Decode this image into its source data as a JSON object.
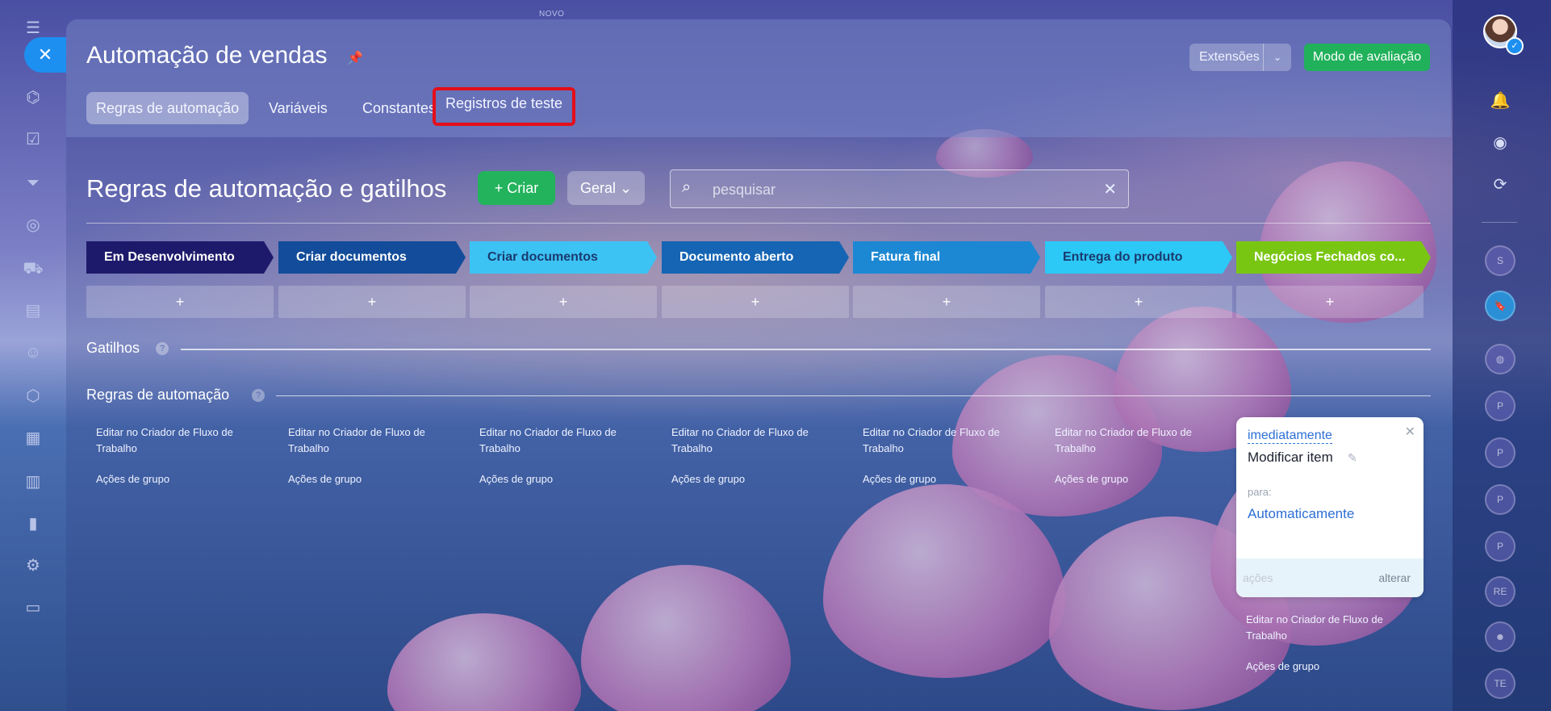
{
  "topbar": {
    "novo_label": "NOVO"
  },
  "header": {
    "title": "Automação de vendas",
    "extensions_label": "Extensões",
    "demo_mode_label": "Modo de avaliação"
  },
  "tabs": [
    {
      "label": "Regras de automação"
    },
    {
      "label": "Variáveis"
    },
    {
      "label": "Constantes"
    },
    {
      "label": "Registros de teste"
    }
  ],
  "toolbar": {
    "section_title": "Regras de automação e gatilhos",
    "create_label": "Criar",
    "general_label": "Geral",
    "search_placeholder": "pesquisar"
  },
  "stages": [
    {
      "label": "Em Desenvolvimento",
      "color": "#1e1a6b",
      "text_color": "#ffffff"
    },
    {
      "label": "Criar documentos",
      "color": "#124c9a",
      "text_color": "#ffffff"
    },
    {
      "label": "Criar documentos",
      "color": "#3cc3f4",
      "text_color": "#1b3a6e"
    },
    {
      "label": "Documento aberto",
      "color": "#1565b4",
      "text_color": "#ffffff"
    },
    {
      "label": "Fatura final",
      "color": "#1c88d3",
      "text_color": "#ffffff"
    },
    {
      "label": "Entrega do produto",
      "color": "#2cc8f6",
      "text_color": "#1b3a6e"
    },
    {
      "label": "Negócios Fechados co...",
      "color": "#79c612",
      "text_color": "#ffffff"
    }
  ],
  "add_symbol": "+",
  "sections": {
    "triggers_label": "Gatilhos",
    "rules_label": "Regras de automação",
    "help_symbol": "?"
  },
  "columns": {
    "edit_link": "Editar no Criador de Fluxo de Trabalho",
    "group_actions": "Ações de grupo"
  },
  "rule_card": {
    "when": "imediatamente",
    "action": "Modificar item",
    "for_label": "para:",
    "for_value": "Automaticamente",
    "footer_actions": "ações",
    "footer_change": "alterar"
  },
  "right_rail": {
    "avatars": [
      "S",
      "",
      "",
      "P",
      "P",
      "P",
      "P",
      "RE",
      "",
      "TE"
    ]
  },
  "colors": {
    "accent_green": "#22b35c",
    "accent_blue": "#1d8ff0",
    "highlight_red": "#e40f1a"
  }
}
